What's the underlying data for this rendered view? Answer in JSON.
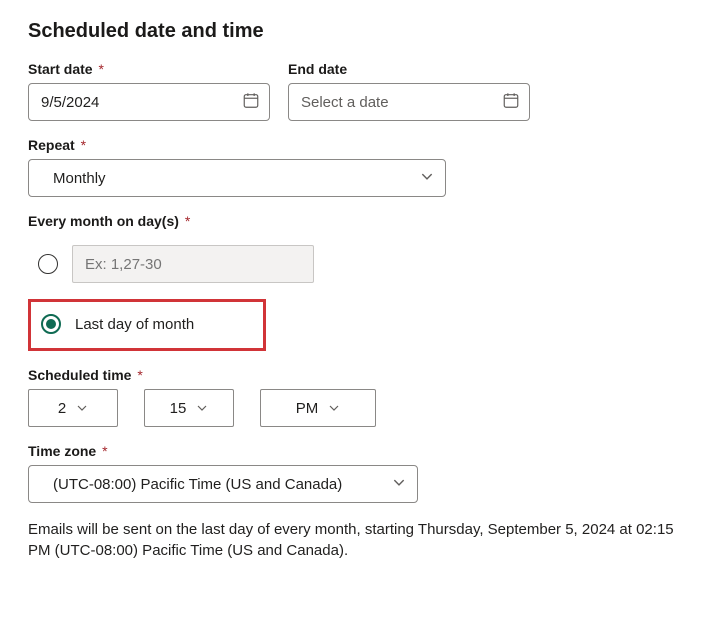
{
  "section_heading": "Scheduled date and time",
  "start_date": {
    "label": "Start date",
    "value": "9/5/2024",
    "required": true
  },
  "end_date": {
    "label": "End date",
    "placeholder": "Select a date",
    "required": false
  },
  "repeat": {
    "label": "Repeat",
    "required": true,
    "selected": "Monthly"
  },
  "every_month": {
    "label": "Every month on day(s)",
    "required": true,
    "option_specific": {
      "placeholder": "Ex: 1,27-30",
      "selected": false
    },
    "option_last_day": {
      "label": "Last day of month",
      "selected": true
    }
  },
  "scheduled_time": {
    "label": "Scheduled time",
    "required": true,
    "hour": "2",
    "minute": "15",
    "meridiem": "PM"
  },
  "time_zone": {
    "label": "Time zone",
    "required": true,
    "selected": "(UTC-08:00) Pacific Time (US and Canada)"
  },
  "summary": "Emails will be sent on the last day of every month, starting Thursday, September 5, 2024 at 02:15 PM (UTC-08:00) Pacific Time (US and Canada)."
}
